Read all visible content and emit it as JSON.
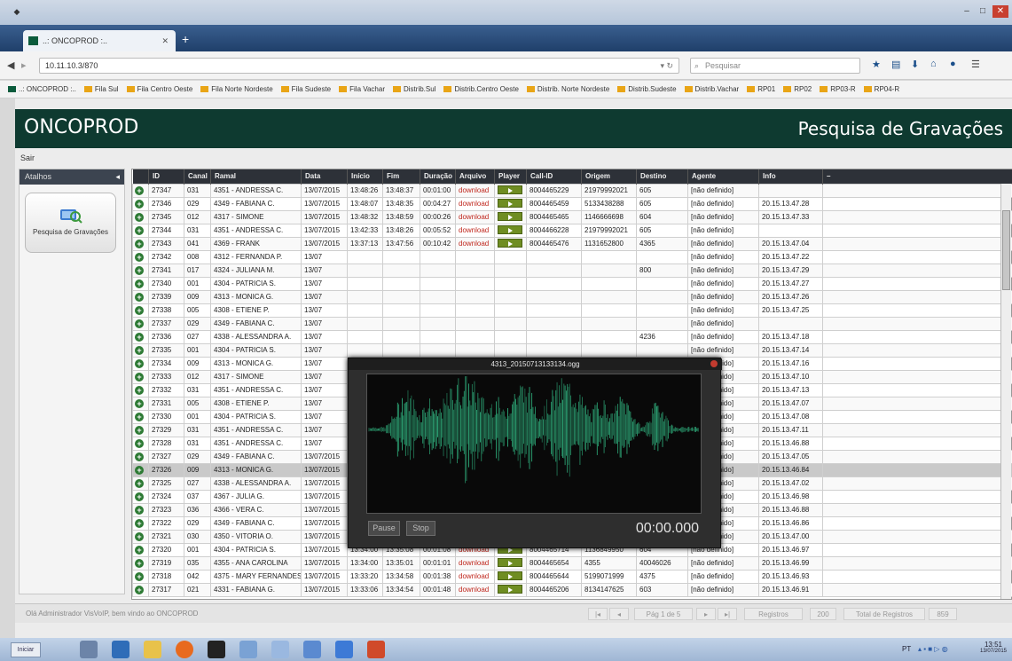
{
  "browser": {
    "tab_title": "..: ONCOPROD :..",
    "remote_title": "servidor_rm",
    "url": "10.11.10.3/870",
    "search_placeholder": "Pesquisar",
    "bookmarks": [
      "..: ONCOPROD :..",
      "Fila Sul",
      "Fila Centro Oeste",
      "Fila Norte Nordeste",
      "Fila Sudeste",
      "Fila Vachar",
      "Distrib.Sul",
      "Distrib.Centro Oeste",
      "Distrib. Norte Nordeste",
      "Distrib.Sudeste",
      "Distrib.Vachar",
      "RP01",
      "RP02",
      "RP03-R",
      "RP04-R"
    ]
  },
  "app": {
    "brand": "ONCOPROD",
    "page_title": "Pesquisa de Gravações",
    "logout": "Sair"
  },
  "sidebar": {
    "header": "Atalhos",
    "shortcut_label": "Pesquisa de Gravações"
  },
  "table": {
    "columns": [
      "ID",
      "Canal",
      "Ramal",
      "Data",
      "Início",
      "Fim",
      "Duração",
      "Arquivo",
      "Player",
      "Call-ID",
      "Origem",
      "Destino",
      "Agente",
      "Info"
    ],
    "rows": [
      [
        "27347",
        "031",
        "4351 - ANDRESSA C.",
        "13/07/2015",
        "13:48:26",
        "13:48:37",
        "00:01:00",
        "download",
        "8004465229",
        "21979992021",
        "605",
        "[não definido]",
        ""
      ],
      [
        "27346",
        "029",
        "4349 - FABIANA C.",
        "13/07/2015",
        "13:48:07",
        "13:48:35",
        "00:04:27",
        "download",
        "8004465459",
        "5133438288",
        "605",
        "[não definido]",
        "20.15.13.47.28"
      ],
      [
        "27345",
        "012",
        "4317 - SIMONE",
        "13/07/2015",
        "13:48:32",
        "13:48:59",
        "00:00:26",
        "download",
        "8004465465",
        "1146666698",
        "604",
        "[não definido]",
        "20.15.13.47.33"
      ],
      [
        "27344",
        "031",
        "4351 - ANDRESSA C.",
        "13/07/2015",
        "13:42:33",
        "13:48:26",
        "00:05:52",
        "download",
        "8004466228",
        "21979992021",
        "605",
        "[não definido]",
        ""
      ],
      [
        "27343",
        "041",
        "4369 - FRANK",
        "13/07/2015",
        "13:37:13",
        "13:47:56",
        "00:10:42",
        "download",
        "8004465476",
        "1131652800",
        "4365",
        "[não definido]",
        "20.15.13.47.04"
      ],
      [
        "27342",
        "008",
        "4312 - FERNANDA P.",
        "13/07",
        "",
        "",
        "",
        "",
        "",
        "",
        "",
        "[não definido]",
        "20.15.13.47.22"
      ],
      [
        "27341",
        "017",
        "4324 - JULIANA M.",
        "13/07",
        "",
        "",
        "",
        "",
        "",
        "",
        "800",
        "[não definido]",
        "20.15.13.47.29"
      ],
      [
        "27340",
        "001",
        "4304 - PATRICIA S.",
        "13/07",
        "",
        "",
        "",
        "",
        "",
        "",
        "",
        "[não definido]",
        "20.15.13.47.27"
      ],
      [
        "27339",
        "009",
        "4313 - MONICA G.",
        "13/07",
        "",
        "",
        "",
        "",
        "",
        "",
        "",
        "[não definido]",
        "20.15.13.47.26"
      ],
      [
        "27338",
        "005",
        "4308 - ETIENE P.",
        "13/07",
        "",
        "",
        "",
        "",
        "",
        "",
        "",
        "[não definido]",
        "20.15.13.47.25"
      ],
      [
        "27337",
        "029",
        "4349 - FABIANA C.",
        "13/07",
        "",
        "",
        "",
        "",
        "",
        "",
        "",
        "[não definido]",
        ""
      ],
      [
        "27336",
        "027",
        "4338 - ALESSANDRA A.",
        "13/07",
        "",
        "",
        "",
        "",
        "",
        "",
        "4236",
        "[não definido]",
        "20.15.13.47.18"
      ],
      [
        "27335",
        "001",
        "4304 - PATRICIA S.",
        "13/07",
        "",
        "",
        "",
        "",
        "",
        "",
        "",
        "[não definido]",
        "20.15.13.47.14"
      ],
      [
        "27334",
        "009",
        "4313 - MONICA G.",
        "13/07",
        "",
        "",
        "",
        "",
        "",
        "",
        "",
        "[não definido]",
        "20.15.13.47.16"
      ],
      [
        "27333",
        "012",
        "4317 - SIMONE",
        "13/07",
        "",
        "",
        "",
        "",
        "",
        "",
        "",
        "[não definido]",
        "20.15.13.47.10"
      ],
      [
        "27332",
        "031",
        "4351 - ANDRESSA C.",
        "13/07",
        "",
        "",
        "",
        "",
        "",
        "",
        "",
        "[não definido]",
        "20.15.13.47.13"
      ],
      [
        "27331",
        "005",
        "4308 - ETIENE P.",
        "13/07",
        "",
        "",
        "",
        "",
        "",
        "",
        "",
        "[não definido]",
        "20.15.13.47.07"
      ],
      [
        "27330",
        "001",
        "4304 - PATRICIA S.",
        "13/07",
        "",
        "",
        "",
        "",
        "",
        "",
        "",
        "[não definido]",
        "20.15.13.47.08"
      ],
      [
        "27329",
        "031",
        "4351 - ANDRESSA C.",
        "13/07",
        "",
        "",
        "",
        "",
        "",
        "",
        "",
        "[não definido]",
        "20.15.13.47.11"
      ],
      [
        "27328",
        "031",
        "4351 - ANDRESSA C.",
        "13/07",
        "",
        "",
        "",
        "",
        "",
        "",
        "",
        "[não definido]",
        "20.15.13.46.88"
      ],
      [
        "27327",
        "029",
        "4349 - FABIANA C.",
        "13/07/2015",
        "13:35:13",
        "13:38:05",
        "00:02:51",
        "download",
        "8004465717",
        "1132572758",
        "605",
        "[não definido]",
        "20.15.13.47.05"
      ],
      [
        "27326",
        "009",
        "4313 - MONICA G.",
        "13/07/2015",
        "13:31:34",
        "13:37:48",
        "00:06:14",
        "download",
        "8004465754",
        "4313",
        "900031049",
        "[não definido]",
        "20.15.13.46.84"
      ],
      [
        "27325",
        "027",
        "4338 - ALESSANDRA A.",
        "13/07/2015",
        "13:35:33",
        "13:37:10",
        "00:01:37",
        "download",
        "8004465630",
        "4338",
        "04133114000",
        "[não definido]",
        "20.15.13.47.02"
      ],
      [
        "27324",
        "037",
        "4367 - JULIA G.",
        "13/07/2015",
        "13:36:23",
        "13:36:01",
        "00:00:37",
        "download",
        "8004465731",
        "4367",
        "7560",
        "[não definido]",
        "20.15.13.46.98"
      ],
      [
        "27323",
        "036",
        "4366 - VERA C.",
        "13/07/2015",
        "13:28:12",
        "13:35:58",
        "00:07:45",
        "download",
        "8004465484",
        "4366",
        "01938175006",
        "[não definido]",
        "20.15.13.46.88"
      ],
      [
        "27322",
        "029",
        "4349 - FABIANA C.",
        "13/07/2015",
        "13:31:42",
        "13:35:14",
        "00:03:32",
        "download",
        "8004465673",
        "1136849950",
        "4349",
        "[não definido]",
        "20.15.13.46.86"
      ],
      [
        "27321",
        "030",
        "4350 - VITORIA O.",
        "13/07/2015",
        "13:34:15",
        "13:35:11",
        "00:00:56",
        "download",
        "8004466224",
        "1132572758",
        "605",
        "[não definido]",
        "20.15.13.47.00"
      ],
      [
        "27320",
        "001",
        "4304 - PATRICIA S.",
        "13/07/2015",
        "13:34:00",
        "13:35:08",
        "00:01:08",
        "download",
        "8004465714",
        "1136849950",
        "604",
        "[não definido]",
        "20.15.13.46.97"
      ],
      [
        "27319",
        "035",
        "4355 - ANA CAROLINA",
        "13/07/2015",
        "13:34:00",
        "13:35:01",
        "00:01:01",
        "download",
        "8004465654",
        "4355",
        "40046026",
        "[não definido]",
        "20.15.13.46.99"
      ],
      [
        "27318",
        "042",
        "4375 - MARY FERNANDES",
        "13/07/2015",
        "13:33:20",
        "13:34:58",
        "00:01:38",
        "download",
        "8004465644",
        "5199071999",
        "4375",
        "[não definido]",
        "20.15.13.46.93"
      ],
      [
        "27317",
        "021",
        "4331 - FABIANA G.",
        "13/07/2015",
        "13:33:06",
        "13:34:54",
        "00:01:48",
        "download",
        "8004465206",
        "8134147625",
        "603",
        "[não definido]",
        "20.15.13.46.91"
      ]
    ],
    "selected_index": 21
  },
  "player": {
    "title": "4313_20150713133134.ogg",
    "pause_label": "Pause",
    "stop_label": "Stop",
    "time": "00:00.000",
    "wave_color": "#2fae7c"
  },
  "status": {
    "welcome": "Olá Administrador VisVoIP, bem vindo ao ONCOPROD",
    "page_info": "Pág 1 de 5",
    "records_label": "Registros",
    "records_value": "200",
    "total_label": "Total de Registros",
    "total_value": "859"
  },
  "taskbar": {
    "start": "Iniciar",
    "clock_time": "13:51",
    "clock_date": "13/07/2015",
    "lang": "PT"
  },
  "colors": {
    "header_bg": "#0e3a30",
    "download_link": "#c0281e",
    "row_icon": "#2d7a34",
    "play_button": "#6f8d22"
  }
}
